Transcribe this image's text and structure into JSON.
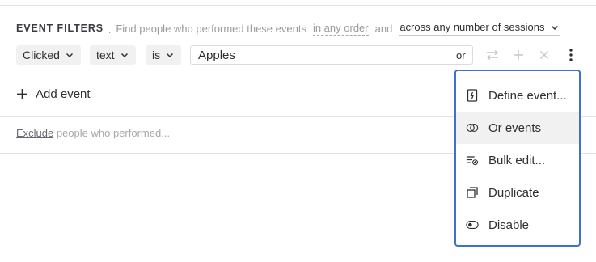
{
  "filters": {
    "title": "EVENT FILTERS",
    "dot": ".",
    "description": "Find people who performed these events",
    "order_link": "in any order",
    "conjunction": "and",
    "sessions_dropdown": "across any number of sessions"
  },
  "condition": {
    "event_type": "Clicked",
    "field": "text",
    "operator": "is",
    "value": "Apples",
    "or_label": "or"
  },
  "add_event_label": "Add event",
  "exclude": {
    "link": "Exclude",
    "text": " people who performed..."
  },
  "menu": {
    "items": [
      {
        "label": "Define event...",
        "icon": "define-event-icon"
      },
      {
        "label": "Or events",
        "icon": "or-events-icon"
      },
      {
        "label": "Bulk edit...",
        "icon": "bulk-edit-icon"
      },
      {
        "label": "Duplicate",
        "icon": "duplicate-icon"
      },
      {
        "label": "Disable",
        "icon": "toggle-icon"
      }
    ],
    "hovered": "Or events"
  },
  "colors": {
    "accent": "#3a73c9",
    "chip_bg": "#f1f1f2",
    "muted_text": "#9a9aa1",
    "disabled_icon": "#c7c7cc"
  }
}
